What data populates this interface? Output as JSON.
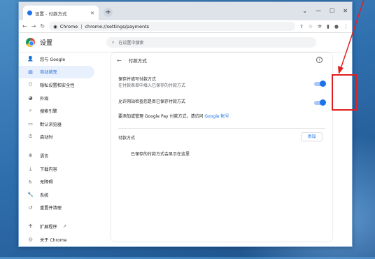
{
  "tab": {
    "title": "设置 - 付款方式"
  },
  "toolbar": {
    "omnibox_site": "Chrome",
    "omnibox_sep": "|",
    "omnibox_url": "chrome://settings/payments"
  },
  "header": {
    "title": "设置",
    "search_placeholder": "在设置中搜索"
  },
  "sidebar": {
    "items": [
      {
        "label": "您与 Google",
        "icon": "person-icon"
      },
      {
        "label": "自动填充",
        "icon": "autofill-icon",
        "active": true
      },
      {
        "label": "隐私设置和安全性",
        "icon": "shield-icon"
      },
      {
        "label": "外观",
        "icon": "palette-icon"
      },
      {
        "label": "搜索引擎",
        "icon": "search-icon"
      },
      {
        "label": "默认浏览器",
        "icon": "browser-icon"
      },
      {
        "label": "启动时",
        "icon": "power-icon"
      },
      {
        "label": "语言",
        "icon": "globe-icon"
      },
      {
        "label": "下载内容",
        "icon": "download-icon"
      },
      {
        "label": "无障碍",
        "icon": "accessibility-icon"
      },
      {
        "label": "系统",
        "icon": "wrench-icon"
      },
      {
        "label": "重置并清理",
        "icon": "reset-icon"
      },
      {
        "label": "扩展程序",
        "icon": "extension-icon"
      },
      {
        "label": "关于 Chrome",
        "icon": "chrome-icon"
      }
    ]
  },
  "payments": {
    "heading": "付款方式",
    "save_title": "保存并填写付款方式",
    "save_sub": "在付款表单中填入已保存的付款方式",
    "check_title": "允许网站检查您是否已保存付款方式",
    "gpay_text": "要添加或管理 Google Pay 付款方式，请访问",
    "gpay_link": "Google 帐号",
    "section_title": "付款方式",
    "add_label": "添加",
    "empty_message": "已保存的付款方式会显示在这里"
  },
  "toggles": {
    "save_enabled": true,
    "check_enabled": true
  },
  "colors": {
    "accent": "#1a73e8",
    "annotation": "#e02020"
  }
}
